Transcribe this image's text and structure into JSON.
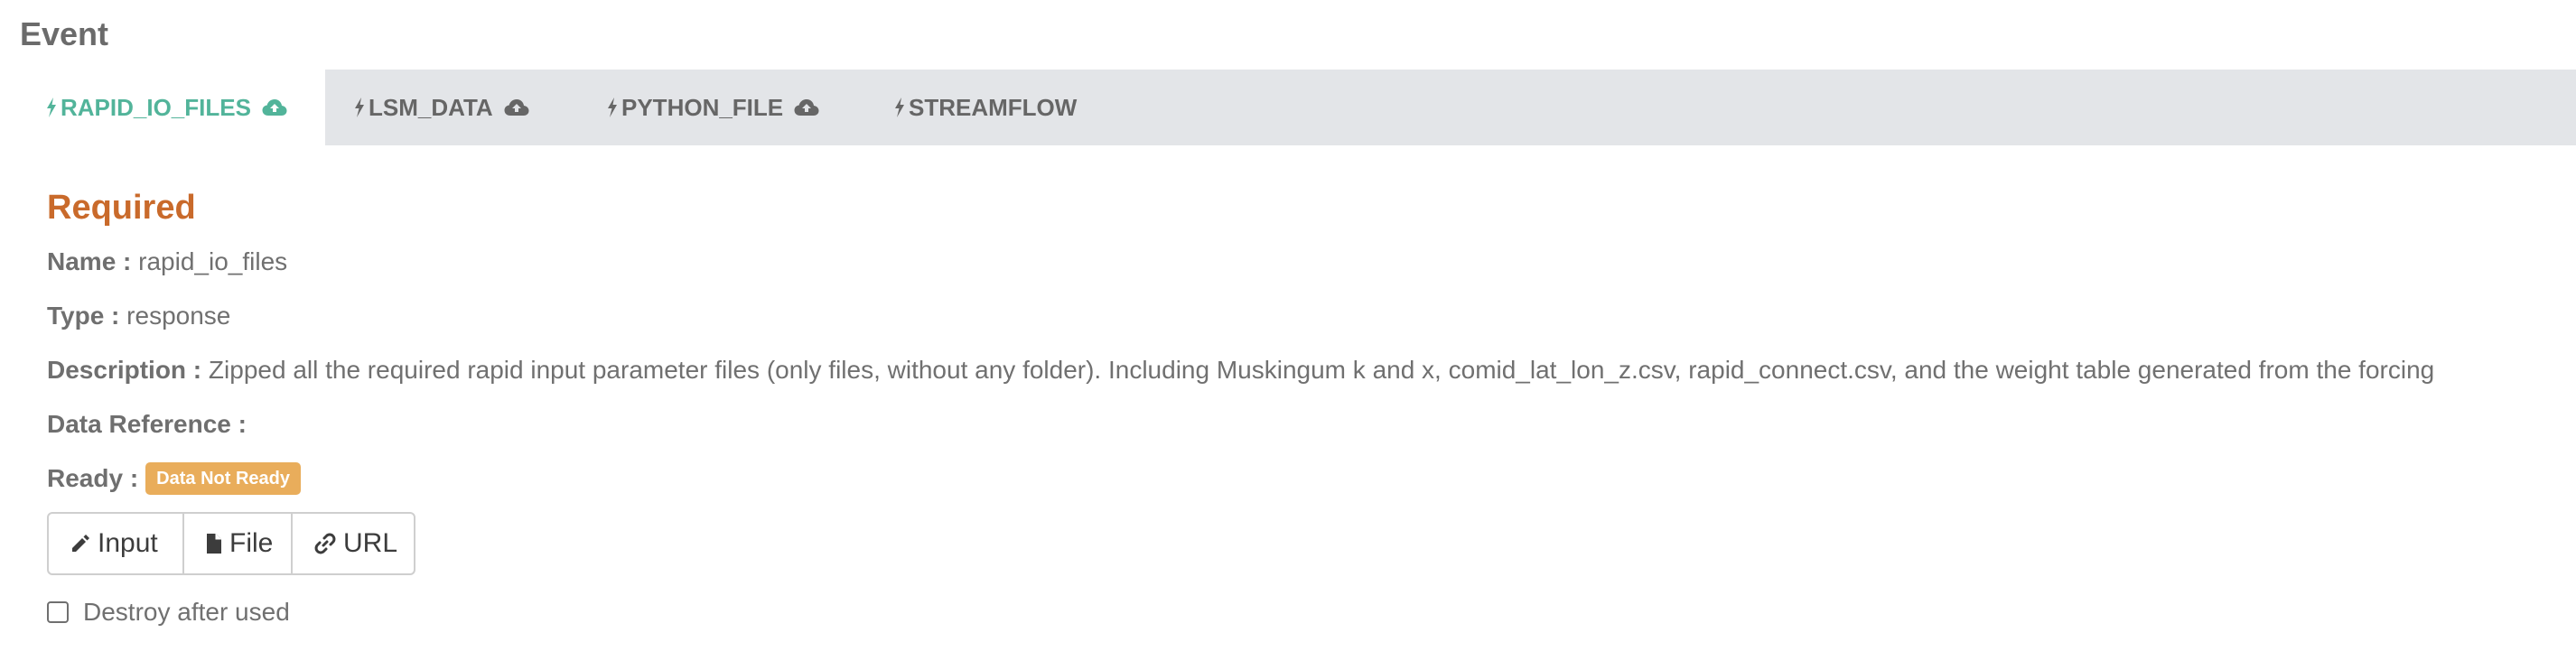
{
  "header": {
    "title": "Event"
  },
  "tabs": [
    {
      "label": "RAPID_IO_FILES",
      "active": true,
      "cloud": true,
      "bolt_icon": "bolt-icon",
      "cloud_icon": "cloud-upload-icon"
    },
    {
      "label": "LSM_DATA",
      "active": false,
      "cloud": true,
      "bolt_icon": "bolt-icon",
      "cloud_icon": "cloud-upload-icon"
    },
    {
      "label": "PYTHON_FILE",
      "active": false,
      "cloud": true,
      "bolt_icon": "bolt-icon",
      "cloud_icon": "cloud-upload-icon"
    },
    {
      "label": "STREAMFLOW",
      "active": false,
      "cloud": false,
      "bolt_icon": "bolt-icon"
    }
  ],
  "section": {
    "title": "Required",
    "name_label": "Name :",
    "name_value": "rapid_io_files",
    "type_label": "Type :",
    "type_value": "response",
    "description_label": "Description :",
    "description_value": "Zipped all the required rapid input parameter files (only files, without any folder). Including Muskingum k and x, comid_lat_lon_z.csv, rapid_connect.csv, and the weight table generated from the forcing",
    "data_reference_label": "Data Reference :",
    "ready_label": "Ready :",
    "ready_badge": "Data Not Ready"
  },
  "buttons": {
    "input_label": "Input",
    "file_label": "File",
    "url_label": "URL",
    "input_icon": "pencil-icon",
    "file_icon": "file-icon",
    "url_icon": "link-icon"
  },
  "options": {
    "destroy_label": "Destroy after used",
    "destroy_checked": false
  },
  "colors": {
    "active_tab": "#52b49a",
    "section_title": "#c96a2b",
    "badge": "#e9ad5b",
    "tabbar": "#e3e5e8"
  }
}
